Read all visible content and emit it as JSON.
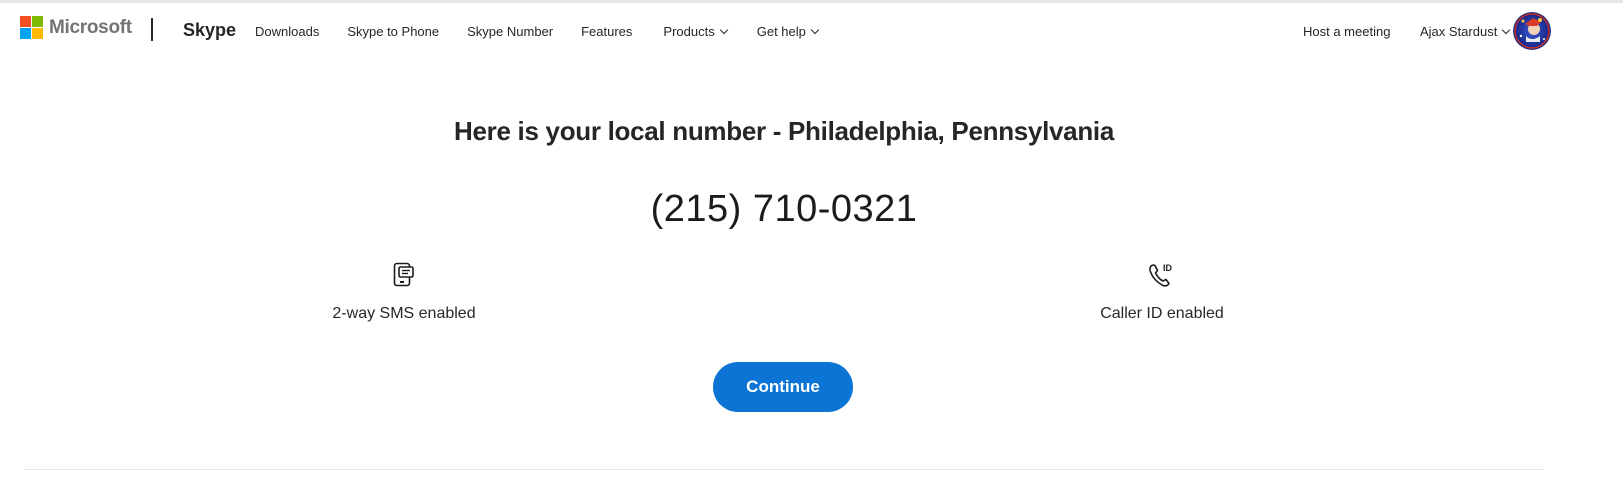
{
  "header": {
    "logo_text": "Microsoft",
    "brand": "Skype",
    "nav": [
      {
        "label": "Downloads",
        "has_dropdown": false
      },
      {
        "label": "Skype to Phone",
        "has_dropdown": false
      },
      {
        "label": "Skype Number",
        "has_dropdown": false
      },
      {
        "label": "Features",
        "has_dropdown": false
      },
      {
        "label": "Products",
        "has_dropdown": true
      },
      {
        "label": "Get help",
        "has_dropdown": true
      }
    ],
    "host_meeting": "Host a meeting",
    "user_name": "Ajax Stardust"
  },
  "main": {
    "title": "Here is your local number - Philadelphia, Pennsylvania",
    "phone_number": "(215) 710-0321",
    "features": [
      {
        "icon": "sms-phone-icon",
        "label": "2-way SMS enabled"
      },
      {
        "icon": "caller-id-icon",
        "label": "Caller ID enabled"
      }
    ],
    "continue_label": "Continue"
  },
  "colors": {
    "accent": "#0c74d4",
    "ms_red": "#f25022",
    "ms_green": "#7fba00",
    "ms_blue": "#00a4ef",
    "ms_yellow": "#ffb900"
  }
}
